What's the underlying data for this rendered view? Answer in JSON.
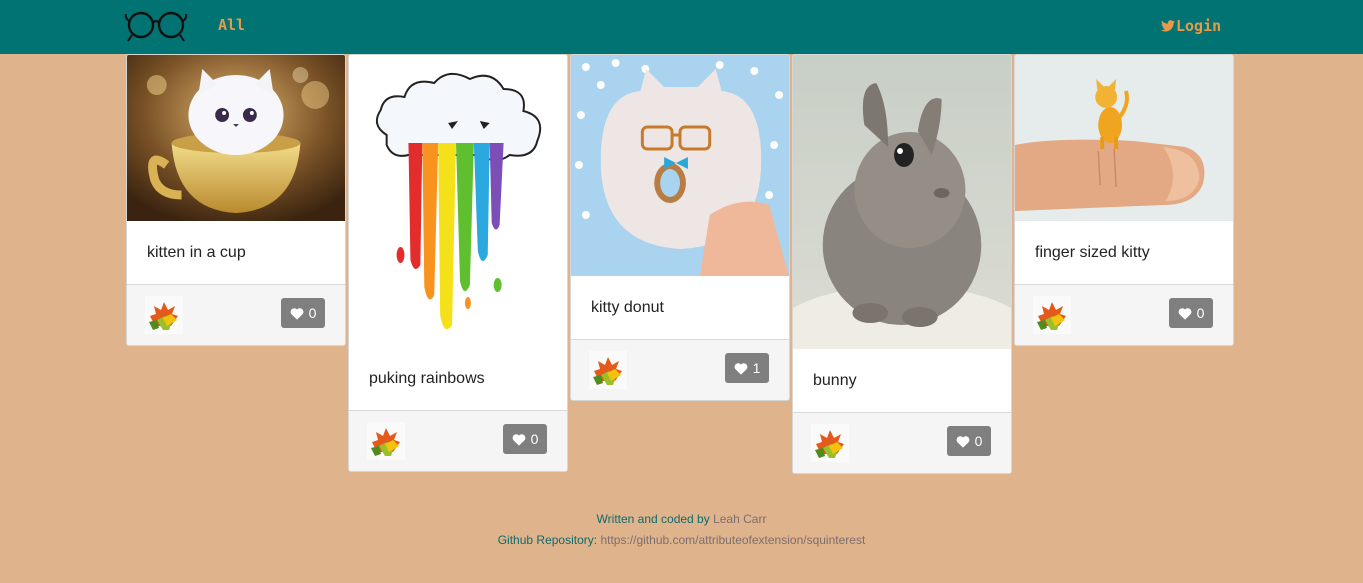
{
  "nav": {
    "all_label": "All",
    "login_label": "Login",
    "login_icon": "twitter-icon",
    "brand_color": "#017373",
    "accent_color": "#e8994a"
  },
  "cards": [
    {
      "title": "kitten in a cup",
      "likes": "0",
      "image": "kitten-in-cup"
    },
    {
      "title": "puking rainbows",
      "likes": "0",
      "image": "rainbow-cloud"
    },
    {
      "title": "kitty donut",
      "likes": "1",
      "image": "cat-donut"
    },
    {
      "title": "bunny",
      "likes": "0",
      "image": "bunny-photo"
    },
    {
      "title": "finger sized kitty",
      "likes": "0",
      "image": "tiny-kitty-on-finger"
    }
  ],
  "footer": {
    "written_by_prefix": "Written and coded by",
    "author": "Leah Carr",
    "repo_prefix": "Github Repository:",
    "repo_url": "https://github.com/attributeofextension/squinterest"
  },
  "colors": {
    "page_bg": "#dfb38b",
    "like_button": "#7f7f7f"
  }
}
